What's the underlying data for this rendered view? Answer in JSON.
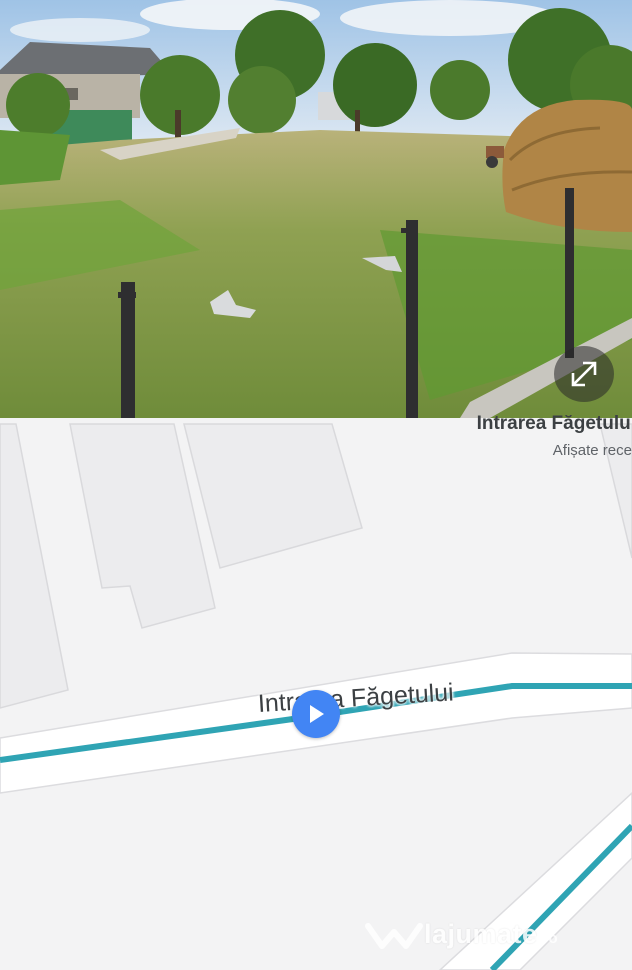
{
  "street_view": {
    "location_title": "Intrarea Făgetului",
    "subtitle": "Afișate rece",
    "expand_icon": "expand-arrows-icon"
  },
  "map": {
    "road_label": "Intrarea Făgetului",
    "play_icon": "play-icon",
    "road_color": "#2fa4b4",
    "marker_color": "#4285f4"
  },
  "watermark": {
    "brand": "lajumate",
    "tld": ".ro"
  }
}
